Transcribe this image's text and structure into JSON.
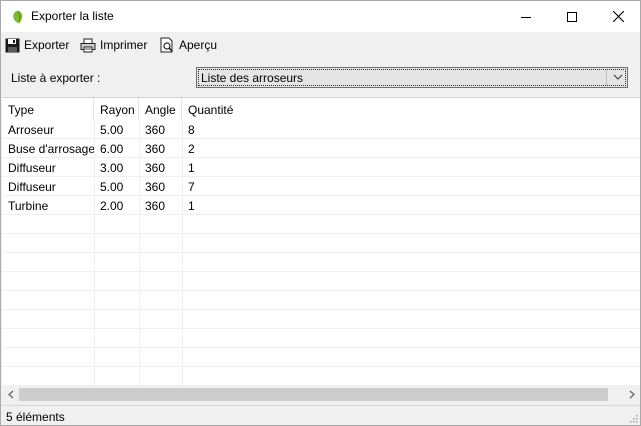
{
  "window": {
    "title": "Exporter la liste"
  },
  "toolbar": {
    "export_label": "Exporter",
    "print_label": "Imprimer",
    "preview_label": "Aperçu"
  },
  "export_list": {
    "label": "Liste à exporter :",
    "selected": "Liste des arroseurs"
  },
  "table": {
    "columns": [
      "Type",
      "Rayon",
      "Angle",
      "Quantité"
    ],
    "rows": [
      [
        "Arroseur",
        "5.00",
        "360",
        "8"
      ],
      [
        "Buse d'arrosage",
        "6.00",
        "360",
        "2"
      ],
      [
        "Diffuseur",
        "3.00",
        "360",
        "1"
      ],
      [
        "Diffuseur",
        "5.00",
        "360",
        "7"
      ],
      [
        "Turbine",
        "2.00",
        "360",
        "1"
      ]
    ]
  },
  "status": {
    "count_text": "5 éléments"
  },
  "icons": {
    "app": "leaf-icon",
    "export": "floppy-disk-icon",
    "print": "printer-icon",
    "preview": "print-preview-icon"
  },
  "colors": {
    "accent": "#7dbb2d",
    "selection_bg": "#e5e5e5"
  }
}
